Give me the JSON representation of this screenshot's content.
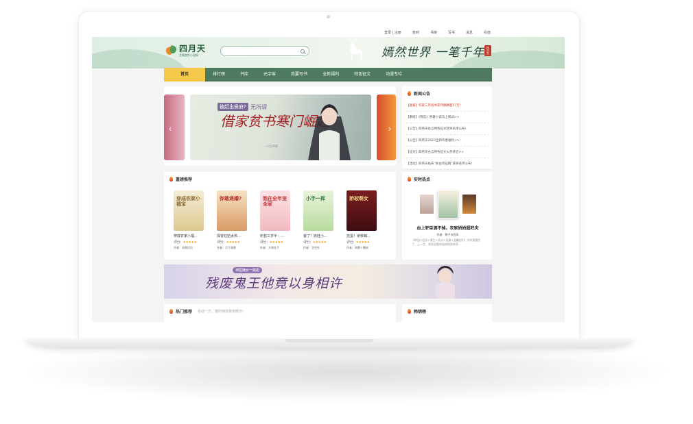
{
  "top_links": [
    "登录 | 注册",
    "签到",
    "书架",
    "写书",
    "消息",
    "充值"
  ],
  "logo": {
    "name": "四月天",
    "subtitle": "言情女性小说网"
  },
  "search": {
    "placeholder": ""
  },
  "slogan": "嫣然世界 一笔千年",
  "seal_text": "四月天",
  "nav": [
    "首页",
    "排行榜",
    "书库",
    "元宇宙",
    "我要写书",
    "全新福利",
    "特色征文",
    "动漫专栏"
  ],
  "carousel": {
    "tag1": "被赶出侯府?",
    "tag2": "无所谓",
    "title": "借家贫书寒门崛起",
    "author": "一只大草草"
  },
  "news": {
    "title": "新闻公告",
    "items": [
      "【喜报】作家三月闯书李月稿酬超57万!",
      "【重磅】《我恋》原著小说马上阅读>>",
      "【公告】四月天古言特色征文获奖名单公布!",
      "【公告】四月天2023全新作者福利>>",
      "【征文】四月天古言特色征文火热开启>>",
      "【活动】四月天站庆“疯古风征稿”获奖名单公布!"
    ]
  },
  "recommend": {
    "title": "重磅推荐",
    "books": [
      {
        "title": "穿成农家小福...",
        "author": "作者：花期迟迟",
        "cover_text": "穿成农家小福宝",
        "c1": "#f4edd8",
        "c2": "#dcc98f",
        "tc": "#8c6a2e"
      },
      {
        "title": "探曾狂妃太热...",
        "author": "作者：月下观歌",
        "cover_text": "你敢退婚?",
        "c1": "#f6e3c4",
        "c2": "#d99a66",
        "tc": "#b52a2a"
      },
      {
        "title": "奶包三岁半：...",
        "author": "作者：大咪金子",
        "cover_text": "我在全年宠全家",
        "c1": "#fbe2e5",
        "c2": "#f2b9bf",
        "tc": "#c33838"
      },
      {
        "title": "爸了！奶娃小...",
        "author": "作者：豆豆外",
        "cover_text": "小手一挥",
        "c1": "#e9f4da",
        "c2": "#b8dba0",
        "tc": "#2f7b3b"
      },
      {
        "title": "完蛋！娇软萌...",
        "author": "作者：胡萝卜糯米",
        "cover_text": "娇软萌女",
        "c1": "#7a1d21",
        "c2": "#3f0d10",
        "tc": "#f6d38a"
      }
    ]
  },
  "hot": {
    "title": "实时热点",
    "book_title": "血上轩臣酒不掉。农家娇娇超旺夫",
    "author": "作者：燕子冰西风",
    "desc": "【种田+团宠+重生+双洁+宠妻+温馨甜文】何所看重生了，上一世，林家因重病省病刚和林家…"
  },
  "ad": {
    "tag": "神医嫡女一路甜",
    "title": "残废鬼王他竟以身相许"
  },
  "hot_rec": {
    "title": "热门推荐",
    "subtitle": "名动一方、敬的咱掉真有眼光!"
  },
  "bestseller": {
    "title": "畅销榜"
  },
  "colors": {
    "nav_bg": "#4d7a60",
    "nav_active": "#f6c84a",
    "accent_red": "#d23c2c"
  }
}
